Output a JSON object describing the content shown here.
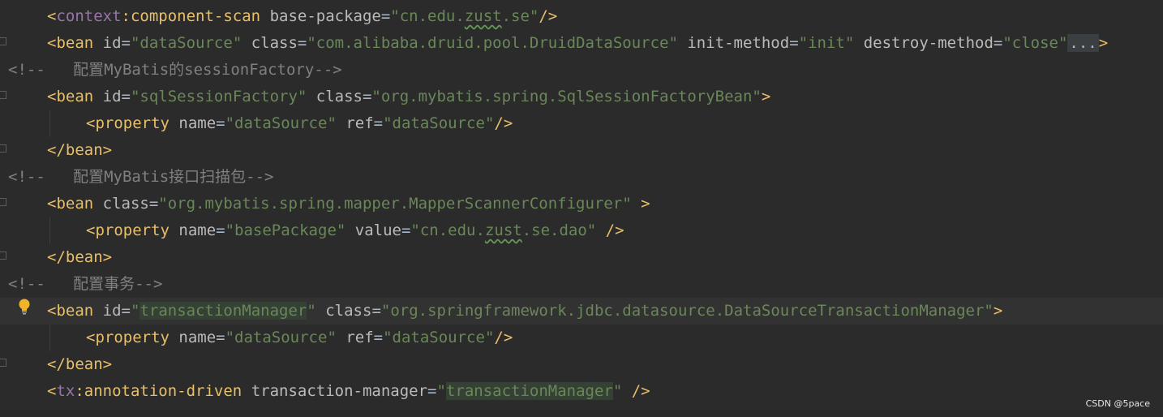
{
  "editor": {
    "lines": [
      {
        "tokens": [
          {
            "t": "<",
            "c": "tagbr"
          },
          {
            "t": "context",
            "c": "ns"
          },
          {
            "t": ":component-scan ",
            "c": "tagbr"
          },
          {
            "t": "base-package",
            "c": "attr"
          },
          {
            "t": "=",
            "c": "eq"
          },
          {
            "t": "\"cn.edu.",
            "c": "val"
          },
          {
            "t": "zust",
            "c": "val typo"
          },
          {
            "t": ".se\"",
            "c": "val"
          },
          {
            "t": "/>",
            "c": "tagbr"
          }
        ]
      },
      {
        "tokens": [
          {
            "t": "<bean ",
            "c": "tagbr"
          },
          {
            "t": "id",
            "c": "attr"
          },
          {
            "t": "=",
            "c": "eq"
          },
          {
            "t": "\"dataSource\" ",
            "c": "val"
          },
          {
            "t": "class",
            "c": "attr"
          },
          {
            "t": "=",
            "c": "eq"
          },
          {
            "t": "\"com.alibaba.druid.pool.DruidDataSource\" ",
            "c": "val"
          },
          {
            "t": "init-method",
            "c": "attr"
          },
          {
            "t": "=",
            "c": "eq"
          },
          {
            "t": "\"init\" ",
            "c": "val"
          },
          {
            "t": "destroy-method",
            "c": "attr"
          },
          {
            "t": "=",
            "c": "eq"
          },
          {
            "t": "\"close\"",
            "c": "val"
          },
          {
            "t": "...",
            "c": "fold-ell"
          },
          {
            "t": ">",
            "c": "tagbr"
          }
        ]
      },
      {
        "tokens": [
          {
            "t": "<!--   配置MyBatis的sessionFactory-->",
            "c": "cmt"
          }
        ]
      },
      {
        "tokens": [
          {
            "t": "<bean ",
            "c": "tagbr"
          },
          {
            "t": "id",
            "c": "attr"
          },
          {
            "t": "=",
            "c": "eq"
          },
          {
            "t": "\"sqlSessionFactory\" ",
            "c": "val"
          },
          {
            "t": "class",
            "c": "attr"
          },
          {
            "t": "=",
            "c": "eq"
          },
          {
            "t": "\"org.mybatis.spring.SqlSessionFactoryBean\"",
            "c": "val"
          },
          {
            "t": ">",
            "c": "tagbr"
          }
        ]
      },
      {
        "tokens": [
          {
            "t": "<property ",
            "c": "tagbr"
          },
          {
            "t": "name",
            "c": "attr"
          },
          {
            "t": "=",
            "c": "eq"
          },
          {
            "t": "\"dataSource\" ",
            "c": "val"
          },
          {
            "t": "ref",
            "c": "attr"
          },
          {
            "t": "=",
            "c": "eq"
          },
          {
            "t": "\"dataSource\"",
            "c": "val"
          },
          {
            "t": "/>",
            "c": "tagbr"
          }
        ]
      },
      {
        "tokens": [
          {
            "t": "</bean>",
            "c": "tagbr"
          }
        ]
      },
      {
        "tokens": [
          {
            "t": "<!--   配置MyBatis接口扫描包-->",
            "c": "cmt"
          }
        ]
      },
      {
        "tokens": [
          {
            "t": "<bean ",
            "c": "tagbr"
          },
          {
            "t": "class",
            "c": "attr"
          },
          {
            "t": "=",
            "c": "eq"
          },
          {
            "t": "\"org.mybatis.spring.mapper.MapperScannerConfigurer\" ",
            "c": "val"
          },
          {
            "t": ">",
            "c": "tagbr"
          }
        ]
      },
      {
        "tokens": [
          {
            "t": "<property ",
            "c": "tagbr"
          },
          {
            "t": "name",
            "c": "attr"
          },
          {
            "t": "=",
            "c": "eq"
          },
          {
            "t": "\"basePackage\" ",
            "c": "val"
          },
          {
            "t": "value",
            "c": "attr"
          },
          {
            "t": "=",
            "c": "eq"
          },
          {
            "t": "\"cn.edu.",
            "c": "val"
          },
          {
            "t": "zust",
            "c": "val typo"
          },
          {
            "t": ".se.dao\" ",
            "c": "val"
          },
          {
            "t": "/>",
            "c": "tagbr"
          }
        ]
      },
      {
        "tokens": [
          {
            "t": "</bean>",
            "c": "tagbr"
          }
        ]
      },
      {
        "tokens": [
          {
            "t": "<!--   配置事务-->",
            "c": "cmt"
          }
        ]
      },
      {
        "tokens": [
          {
            "t": "<bean ",
            "c": "tagbr"
          },
          {
            "t": "id",
            "c": "attr"
          },
          {
            "t": "=",
            "c": "eq"
          },
          {
            "t": "\"",
            "c": "val"
          },
          {
            "t": "transactionManager",
            "c": "val hl-usage"
          },
          {
            "t": "\" ",
            "c": "val"
          },
          {
            "t": "class",
            "c": "attr"
          },
          {
            "t": "=",
            "c": "eq"
          },
          {
            "t": "\"org.springframework.jdbc.datasource.DataSourceTransactionManager\"",
            "c": "val"
          },
          {
            "t": ">",
            "c": "tagbr"
          }
        ]
      },
      {
        "tokens": [
          {
            "t": "<property ",
            "c": "tagbr"
          },
          {
            "t": "name",
            "c": "attr"
          },
          {
            "t": "=",
            "c": "eq"
          },
          {
            "t": "\"dataSource\" ",
            "c": "val"
          },
          {
            "t": "ref",
            "c": "attr"
          },
          {
            "t": "=",
            "c": "eq"
          },
          {
            "t": "\"dataSource\"",
            "c": "val"
          },
          {
            "t": "/>",
            "c": "tagbr"
          }
        ]
      },
      {
        "tokens": [
          {
            "t": "</bean>",
            "c": "tagbr"
          }
        ]
      },
      {
        "tokens": [
          {
            "t": "<",
            "c": "tagbr"
          },
          {
            "t": "tx",
            "c": "ns"
          },
          {
            "t": ":annotation-driven ",
            "c": "tagbr"
          },
          {
            "t": "transaction-manager",
            "c": "attr"
          },
          {
            "t": "=",
            "c": "eq"
          },
          {
            "t": "\"",
            "c": "val"
          },
          {
            "t": "transactionManager",
            "c": "val hl-usage"
          },
          {
            "t": "\" ",
            "c": "val"
          },
          {
            "t": "/>",
            "c": "tagbr"
          }
        ]
      }
    ]
  },
  "watermark": {
    "text": "CSDN @5pace"
  },
  "colors": {
    "background": "#2b2b2b",
    "current_line": "#323232",
    "tag": "#e8bf6a",
    "namespace": "#9876aa",
    "attribute": "#bababa",
    "string": "#6a8759",
    "comment": "#808080",
    "bulb": "#f0b429"
  },
  "icons": {
    "intention": "lightbulb-icon"
  }
}
